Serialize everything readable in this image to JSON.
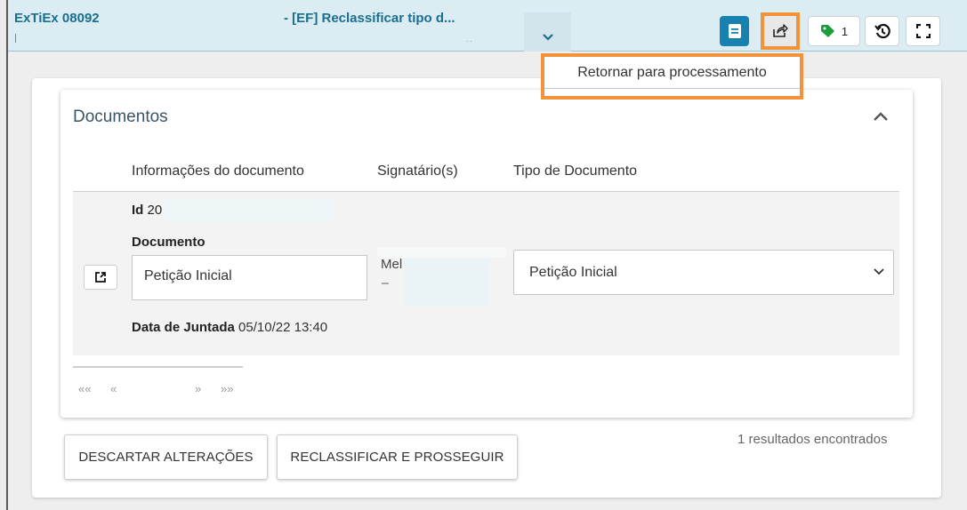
{
  "header": {
    "process_code": "ExTiEx 08092",
    "task_title": "- [EF] Reclassificar tipo d...",
    "task_subtitle": "..",
    "tag_count": "1"
  },
  "share_menu": {
    "items": [
      {
        "label": "Retornar para processamento"
      }
    ]
  },
  "documents": {
    "title": "Documentos",
    "columns": [
      "Informações do documento",
      "Signatário(s)",
      "Tipo de Documento"
    ],
    "row": {
      "id_label": "Id",
      "id_value": "20",
      "document_label": "Documento",
      "document_value": "Petição Inicial",
      "signer": "Mel",
      "doc_type": "Petição Inicial",
      "date_label": "Data de Juntada",
      "date_value": "05/10/22 13:40"
    },
    "pager": {
      "first": "««",
      "prev": "«",
      "next": "»",
      "last": "»»"
    },
    "results": "1 resultados encontrados"
  },
  "actions": {
    "discard": "DESCARTAR ALTERAÇÕES",
    "reclassify": "RECLASSIFICAR E PROSSEGUIR"
  },
  "colors": {
    "accent": "#1781b0",
    "highlight": "#f2923b",
    "header_bg": "#dbecf2",
    "tag_green": "#1e9e3a"
  }
}
